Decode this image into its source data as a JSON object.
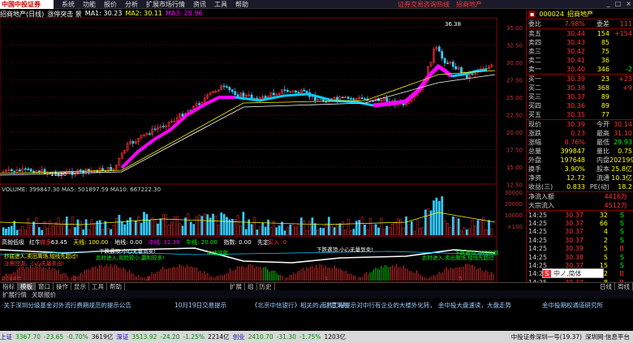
{
  "menu": {
    "logo": "中国中投证券",
    "items": [
      "系统",
      "功能",
      "报价",
      "分析",
      "扩展市场行情",
      "资讯",
      "工具",
      "帮助"
    ],
    "promo": [
      "证券交易咨询热线",
      "招商地产"
    ],
    "window_buttons": [
      "_",
      "□",
      "×"
    ]
  },
  "header": {
    "title": "招商地产(日线)",
    "indicator": "涨停突击 景",
    "ma1": "MA1: 30.23",
    "ma2": "MA2: 30.11",
    "ma3": "MA3: 28.96"
  },
  "price_axis": [
    "35.00",
    "32.50",
    "30.00",
    "27.50",
    "25.00",
    "22.50",
    "20.00",
    "17.50",
    "15.00",
    "12.50"
  ],
  "annotations": {
    "high": "36.38",
    "low": "11.30"
  },
  "volume_header": "VOLUME: 399847.30  MA5: 501897.59  MA10: 667222.30",
  "volume_axis": [
    "30000",
    "20000",
    "10000",
    "×100"
  ],
  "indicator_header": {
    "name": "高抛低吸",
    "items": [
      "红牛",
      "做多",
      "63.45",
      "天线: 100.00",
      "地线: 0.00",
      "中线: 31.39",
      "牛线: 20.00",
      "指数: 0.00",
      "先定:"
    ],
    "right": "买入: 0"
  },
  "indicator_labels": {
    "top_left": "下跌遇顶,小心无量到卖!",
    "left1": "抄底进入,卖出离场,短线先超过!",
    "left2": "注意回调，小心无量卖出!",
    "mid1": "此时进入,风险较小,赢利较多!",
    "mid2": "中线底部",
    "right1": "下跌遇顶,小心无量到卖!",
    "right2": "此时进入,卖出离场,短线先超过",
    "right3": "下跌遇顶,中线底部"
  },
  "x_axis": [
    "2014年",
    "2",
    "3",
    "4",
    "5"
  ],
  "stock": {
    "code": "000024",
    "name": "招商地产"
  },
  "quote": {
    "ratio_label": "委比",
    "ratio": "7.98%",
    "diff_label": "委差",
    "diff": "111",
    "sells": [
      {
        "label": "卖五",
        "price": "30.44",
        "vol": "154",
        "chg": "+154"
      },
      {
        "label": "卖四",
        "price": "30.43",
        "vol": "85",
        "chg": ""
      },
      {
        "label": "卖三",
        "price": "30.42",
        "vol": "75",
        "chg": ""
      },
      {
        "label": "卖二",
        "price": "30.41",
        "vol": "36",
        "chg": ""
      },
      {
        "label": "卖一",
        "price": "30.40",
        "vol": "346",
        "chg": "-2"
      }
    ],
    "buys": [
      {
        "label": "买一",
        "price": "30.39",
        "vol": "23",
        "chg": "+23"
      },
      {
        "label": "买二",
        "price": "30.38",
        "vol": "368",
        "chg": "+9"
      },
      {
        "label": "买三",
        "price": "30.37",
        "vol": "89",
        "chg": ""
      },
      {
        "label": "买四",
        "price": "30.36",
        "vol": "89",
        "chg": ""
      },
      {
        "label": "买五",
        "price": "30.35",
        "vol": "77",
        "chg": ""
      }
    ],
    "stats": [
      {
        "l1": "现价",
        "v1": "30.39",
        "l2": "今开",
        "v2": "30.14"
      },
      {
        "l1": "涨跌",
        "v1": "0.23",
        "l2": "最高",
        "v2": "31.10"
      },
      {
        "l1": "涨幅",
        "v1": "0.76%",
        "l2": "最低",
        "v2": "29.93"
      },
      {
        "l1": "总量",
        "v1": "399847",
        "l2": "量比",
        "v2": "0.75"
      },
      {
        "l1": "外盘",
        "v1": "197648",
        "l2": "内盘",
        "v2": "202199"
      },
      {
        "l1": "换手",
        "v1": "3.90%",
        "l2": "股本",
        "v2": "25.8亿"
      },
      {
        "l1": "净资",
        "v1": "12.72",
        "l2": "流通",
        "v2": "10.3亿"
      },
      {
        "l1": "收益(三)",
        "v1": "0.833",
        "l2": "PE(动)",
        "v2": "18.2"
      }
    ],
    "flow": [
      {
        "label": "净流入额",
        "value": "4416万"
      },
      {
        "label": "大宗流入",
        "value": "4512万"
      }
    ],
    "ticks": [
      {
        "time": "14:25",
        "price": "30.37",
        "vol": "32",
        "dir": "S"
      },
      {
        "time": "14:25",
        "price": "30.37",
        "vol": "66",
        "dir": "S"
      },
      {
        "time": "14:25",
        "price": "30.37",
        "vol": "4",
        "dir": "S"
      },
      {
        "time": "14:25",
        "price": "30.37",
        "vol": "2",
        "dir": "S"
      },
      {
        "time": "14:25",
        "price": "30.39",
        "vol": "5",
        "dir": "B"
      },
      {
        "time": "14:25",
        "price": "30.38",
        "vol": "5",
        "dir": "S"
      },
      {
        "time": "14:25",
        "price": "30.37",
        "vol": "15",
        "dir": "S"
      },
      {
        "time": "14:25",
        "price": "30.37",
        "vol": "212",
        "dir": "B"
      },
      {
        "time": "14:25",
        "price": "30.37",
        "vol": "8",
        "dir": "B"
      },
      {
        "time": "14:25",
        "price": "30.39",
        "vol": "24",
        "dir": "B"
      }
    ]
  },
  "tabs": [
    "指标",
    "模板",
    "窗口",
    "操作",
    "显示",
    "工具",
    "帮助"
  ],
  "tab_active": "模板",
  "mid_tabs": [
    "扩展",
    "组",
    "历史"
  ],
  "subtabs": [
    "扩展行情",
    "关联报价"
  ],
  "tabs_right": [
    "日线",
    "周线"
  ],
  "ticker_news": [
    "·关于深圳分级基金对外流行费期规范的提示公告",
    "10月19日交易提示",
    "《北京中信银行》相关的，注意风险",
    "·南昌工程提示对中行有企业的大楼外化转，",
    "金中投大盘速读，大盘走势",
    "金中投期权通道研究所"
  ],
  "status": {
    "sh_label": "上证",
    "sh": "3367.70",
    "sh_chg": "-23.65",
    "sh_pct": "-0.70%",
    "sh_amt": "3619亿",
    "sz_label": "深证",
    "sz": "3513.92",
    "sz_chg": "-24.20",
    "sz_pct": "-1.25%",
    "sz_amt": "2214亿",
    "cy_label": "创业",
    "cy": "2410.70",
    "cy_chg": "-31.30",
    "cy_pct": "-1.75%",
    "cy_amt": "1203亿",
    "right": "中投证券深圳一号(19.37)",
    "right2": "深圳网·信息平台"
  },
  "sogou": "中ノ,简体"
}
